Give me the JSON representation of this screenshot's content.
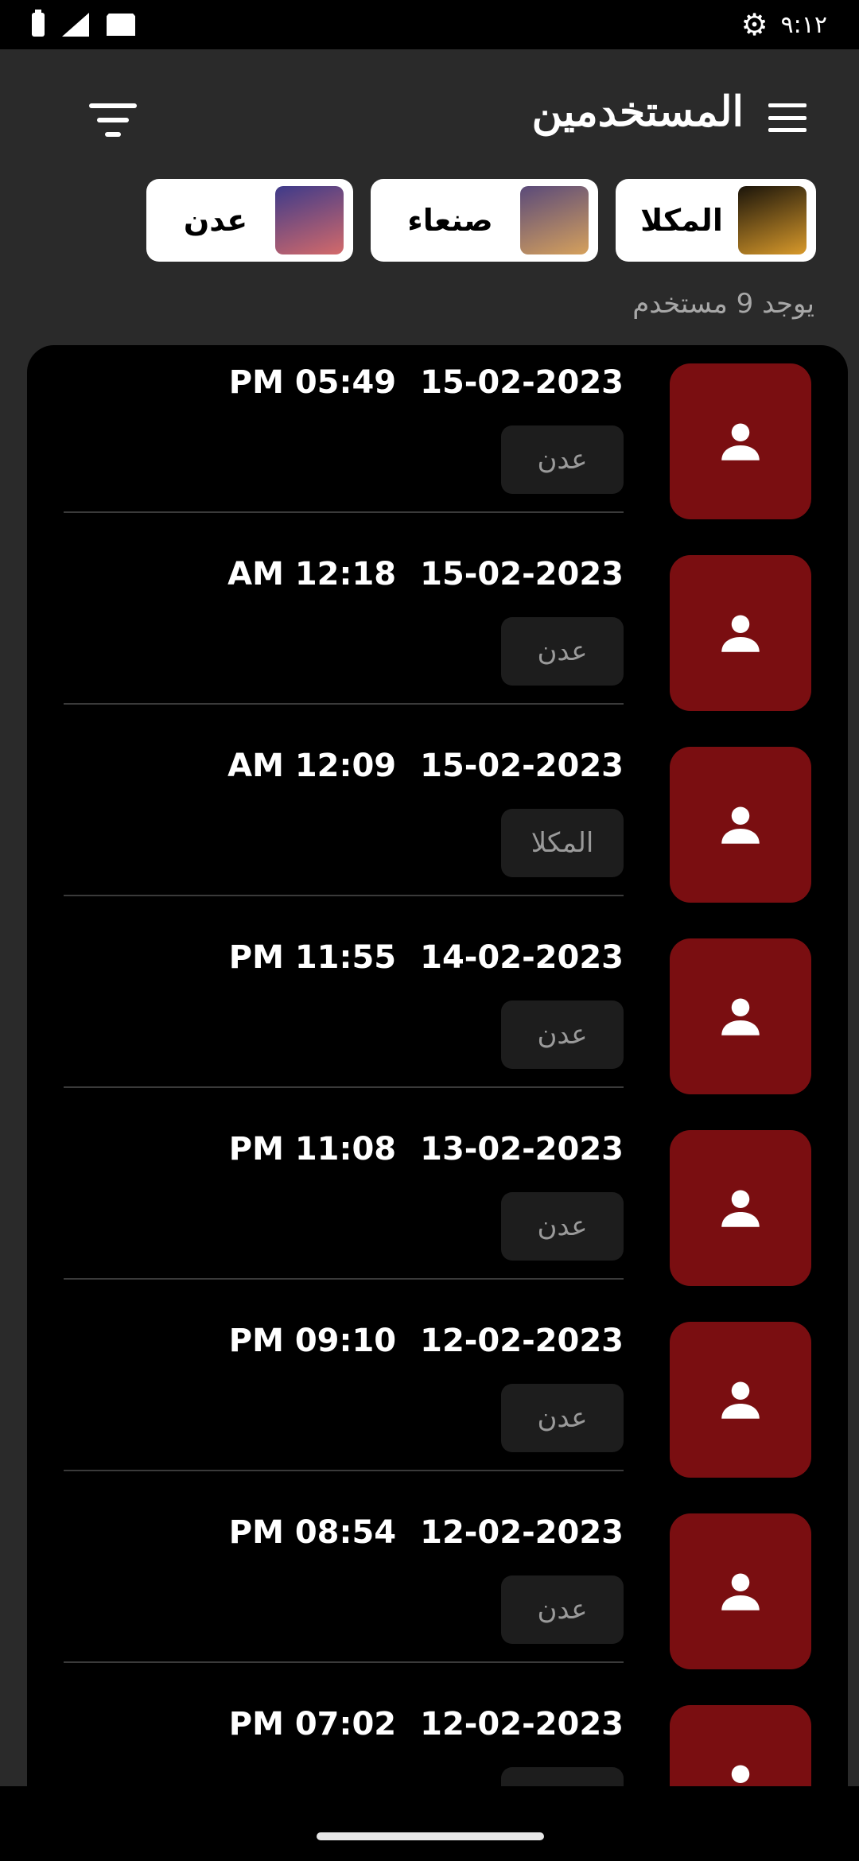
{
  "status_bar": {
    "time": "٩:١٢"
  },
  "header": {
    "title": "المستخدمين"
  },
  "cities": [
    {
      "label": "المكلا",
      "thumb_colors": [
        "#1a140a",
        "#d99a2b"
      ]
    },
    {
      "label": "صنعاء",
      "thumb_colors": [
        "#5a4a7a",
        "#d6a15c"
      ]
    },
    {
      "label": "عدن",
      "thumb_colors": [
        "#3d3a8a",
        "#d46a6a"
      ]
    }
  ],
  "count_text": "يوجد 9 مستخدم",
  "users": [
    {
      "date": "15-02-2023",
      "time": "PM 05:49",
      "city": "عدن"
    },
    {
      "date": "15-02-2023",
      "time": "AM 12:18",
      "city": "عدن"
    },
    {
      "date": "15-02-2023",
      "time": "AM 12:09",
      "city": "المكلا"
    },
    {
      "date": "14-02-2023",
      "time": "PM 11:55",
      "city": "عدن"
    },
    {
      "date": "13-02-2023",
      "time": "PM 11:08",
      "city": "عدن"
    },
    {
      "date": "12-02-2023",
      "time": "PM 09:10",
      "city": "عدن"
    },
    {
      "date": "12-02-2023",
      "time": "PM 08:54",
      "city": "عدن"
    },
    {
      "date": "12-02-2023",
      "time": "PM 07:02",
      "city": ""
    }
  ],
  "colors": {
    "background": "#2a2a2a",
    "list_background": "#000000",
    "avatar": "#7a0e11",
    "badge": "#1d1d1d"
  }
}
